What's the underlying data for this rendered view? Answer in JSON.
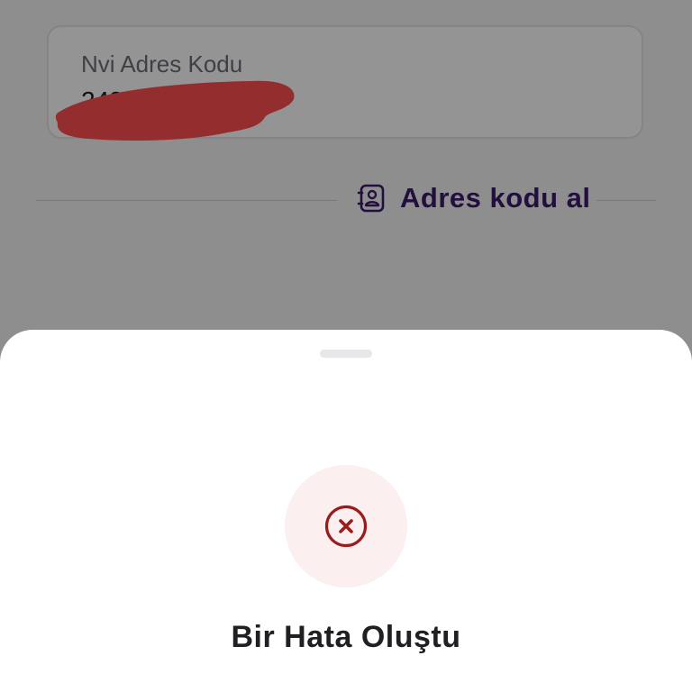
{
  "form": {
    "nvi_field": {
      "label": "Nvi Adres Kodu",
      "value": "24885"
    },
    "redaction_color": "#ff4f4f",
    "address_link": {
      "label": "Adres kodu al",
      "icon": "id-card-icon",
      "color": "#3b1a6b"
    }
  },
  "sheet": {
    "icon": "error-x-circle-icon",
    "icon_color": "#9b1b1b",
    "title": "Bir Hata Oluştu"
  }
}
